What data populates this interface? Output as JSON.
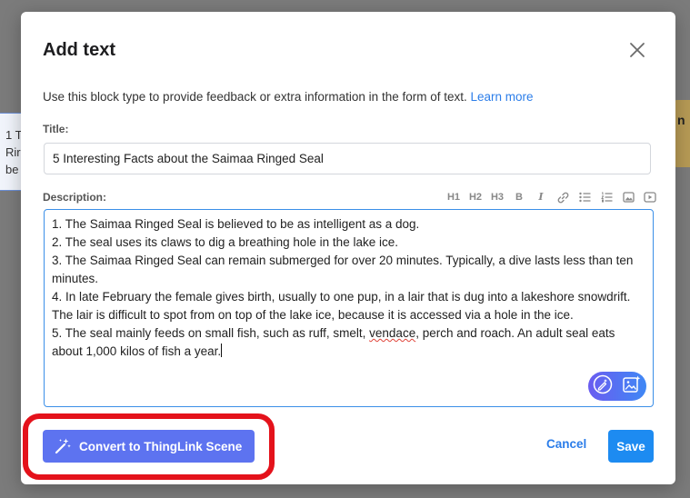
{
  "background": {
    "left_card_lines": [
      "1 T",
      "Rir",
      "be"
    ],
    "right_card_text": "n"
  },
  "modal": {
    "title": "Add text",
    "intro_text": "Use this block type to provide feedback or extra information in the form of text.",
    "learn_more": "Learn more",
    "title_label": "Title:",
    "title_value": "5 Interesting Facts about the Saimaa Ringed Seal",
    "description_label": "Description:",
    "toolbar": {
      "h1": "H1",
      "h2": "H2",
      "h3": "H3",
      "bold": "B",
      "italic": "I"
    },
    "description_lines": {
      "l1": "1. The Saimaa Ringed Seal is believed to be as intelligent as a dog.",
      "l2": "2. The seal uses its claws to dig a breathing hole in the lake ice.",
      "l3": "3. The Saimaa Ringed Seal can remain submerged for over 20 minutes. Typically, a dive lasts less than ten minutes.",
      "l4": "4. In late February the female gives birth, usually to one pup, in a lair that is dug into a lakeshore snowdrift. The lair is difficult to spot from on top of the lake ice, because it is accessed via a hole in the ice.",
      "l5_a": "5. The seal mainly feeds on small fish, such as ruff, smelt, ",
      "l5_b": "vendace",
      "l5_c": ", perch and roach. An adult seal eats about 1,000 kilos of fish a year."
    },
    "convert_button": "Convert to ThingLink Scene",
    "cancel_button": "Cancel",
    "save_button": "Save"
  },
  "colors": {
    "accent": "#2b7de9",
    "save": "#1d8bf1",
    "convert": "#5d73f0",
    "highlight": "#e4121b"
  }
}
